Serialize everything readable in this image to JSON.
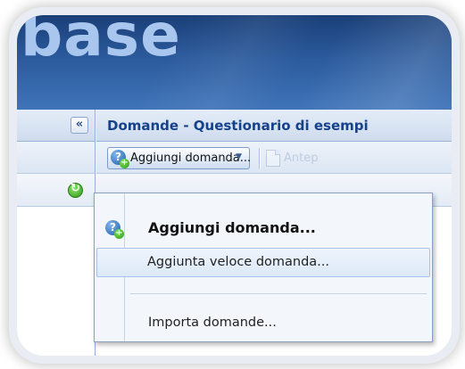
{
  "app": {
    "brand_fragment": "base"
  },
  "left_panel": {
    "collapse_glyph": "«"
  },
  "main_panel": {
    "title": "Domande - Questionario di esempi",
    "toolbar": {
      "add_question_label": "Aggiungi domanda...",
      "add_question_arrow": "▼",
      "preview_label": "Antep"
    }
  },
  "dropdown_menu": {
    "items": [
      {
        "label": "Aggiungi domanda...",
        "icon": "help-plus-icon",
        "bold": true
      },
      {
        "label": "Aggiunta veloce domanda...",
        "icon": null,
        "highlighted": true
      },
      {
        "label": "Importa domande...",
        "icon": null
      }
    ]
  },
  "colors": {
    "header_dark": "#1a3f78",
    "title_text": "#15428b",
    "panel_border": "#99b3d6"
  }
}
